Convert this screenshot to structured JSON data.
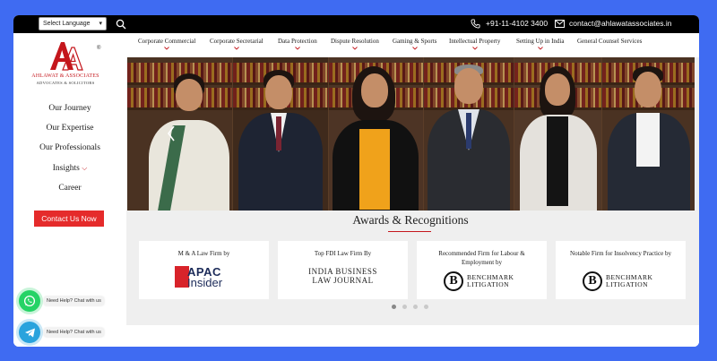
{
  "topbar": {
    "language_select": "Select Language",
    "phone": "+91-11-4102 3400",
    "email": "contact@ahlawatassociates.in"
  },
  "logo": {
    "registered": "®",
    "name": "AHLAWAT & ASSOCIATES",
    "subtitle": "ADVOCATES & SOLICITORS"
  },
  "sidebar": {
    "items": [
      {
        "label": "Our Journey"
      },
      {
        "label": "Our Expertise"
      },
      {
        "label": "Our Professionals"
      },
      {
        "label": "Insights"
      },
      {
        "label": "Career"
      }
    ],
    "contact_button": "Contact Us Now"
  },
  "chat": {
    "whatsapp_label": "Need Help? Chat with us",
    "telegram_label": "Need Help? Chat with us"
  },
  "nav": {
    "items": [
      {
        "label": "Corporate Commercial"
      },
      {
        "label": "Corporate Secretarial"
      },
      {
        "label": "Data Protection"
      },
      {
        "label": "Dispute Resolution"
      },
      {
        "label": "Gaming & Sports"
      },
      {
        "label": "Intellectual Property"
      },
      {
        "label": "Setting Up in India"
      },
      {
        "label": "General Counsel Services"
      }
    ]
  },
  "awards": {
    "title": "Awards & Recognitions",
    "cards": [
      {
        "text": "M & A Law Firm by",
        "logo_line1": "APAC",
        "logo_line2": "Insider"
      },
      {
        "text": "Top FDI Law Firm By",
        "logo_line1": "INDIA BUSINESS",
        "logo_line2": "LAW JOURNAL"
      },
      {
        "text": "Recommended Firm for Labour & Employment by",
        "logo_line1": "BENCHMARK",
        "logo_line2": "LITIGATION"
      },
      {
        "text": "Notable Firm for Insolvency Practice by",
        "logo_line1": "BENCHMARK",
        "logo_line2": "LITIGATION"
      }
    ],
    "prev": "‹",
    "next": "›"
  },
  "colors": {
    "brand_red": "#c4161c",
    "button_red": "#e52b2b",
    "page_bg": "#3f6bf2",
    "topbar_bg": "#000000",
    "whatsapp": "#25d366",
    "telegram": "#2aa3dd"
  }
}
